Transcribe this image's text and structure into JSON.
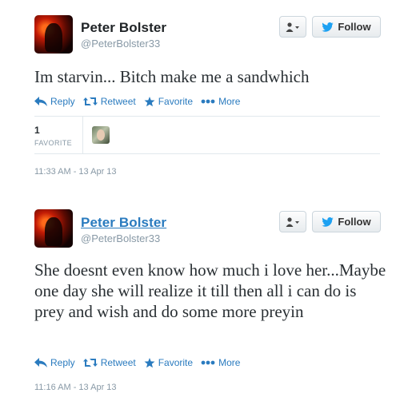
{
  "tweets": [
    {
      "author_name": "Peter Bolster",
      "author_handle": "@PeterBolster33",
      "text": "Im starvin... Bitch make me a sandwhich",
      "follow_label": "Follow",
      "actions": {
        "reply": "Reply",
        "retweet": "Retweet",
        "favorite": "Favorite",
        "more": "More"
      },
      "favorite_count": "1",
      "favorite_label": "FAVORITE",
      "timestamp": "11:33 AM - 13 Apr 13"
    },
    {
      "author_name": "Peter Bolster",
      "author_handle": "@PeterBolster33",
      "text": "She doesnt even know how much i love her...Maybe one day she will realize it till then all i can do is prey and wish and do some more preyin",
      "follow_label": "Follow",
      "actions": {
        "reply": "Reply",
        "retweet": "Retweet",
        "favorite": "Favorite",
        "more": "More"
      },
      "timestamp": "11:16 AM - 13 Apr 13"
    }
  ],
  "colors": {
    "link": "#2a7bbf",
    "muted": "#8899a6",
    "text": "#292f33",
    "twitter_blue": "#1da1f2"
  },
  "icons": [
    "user-menu-icon",
    "twitter-bird-icon",
    "reply-icon",
    "retweet-icon",
    "favorite-star-icon",
    "more-dots-icon"
  ]
}
